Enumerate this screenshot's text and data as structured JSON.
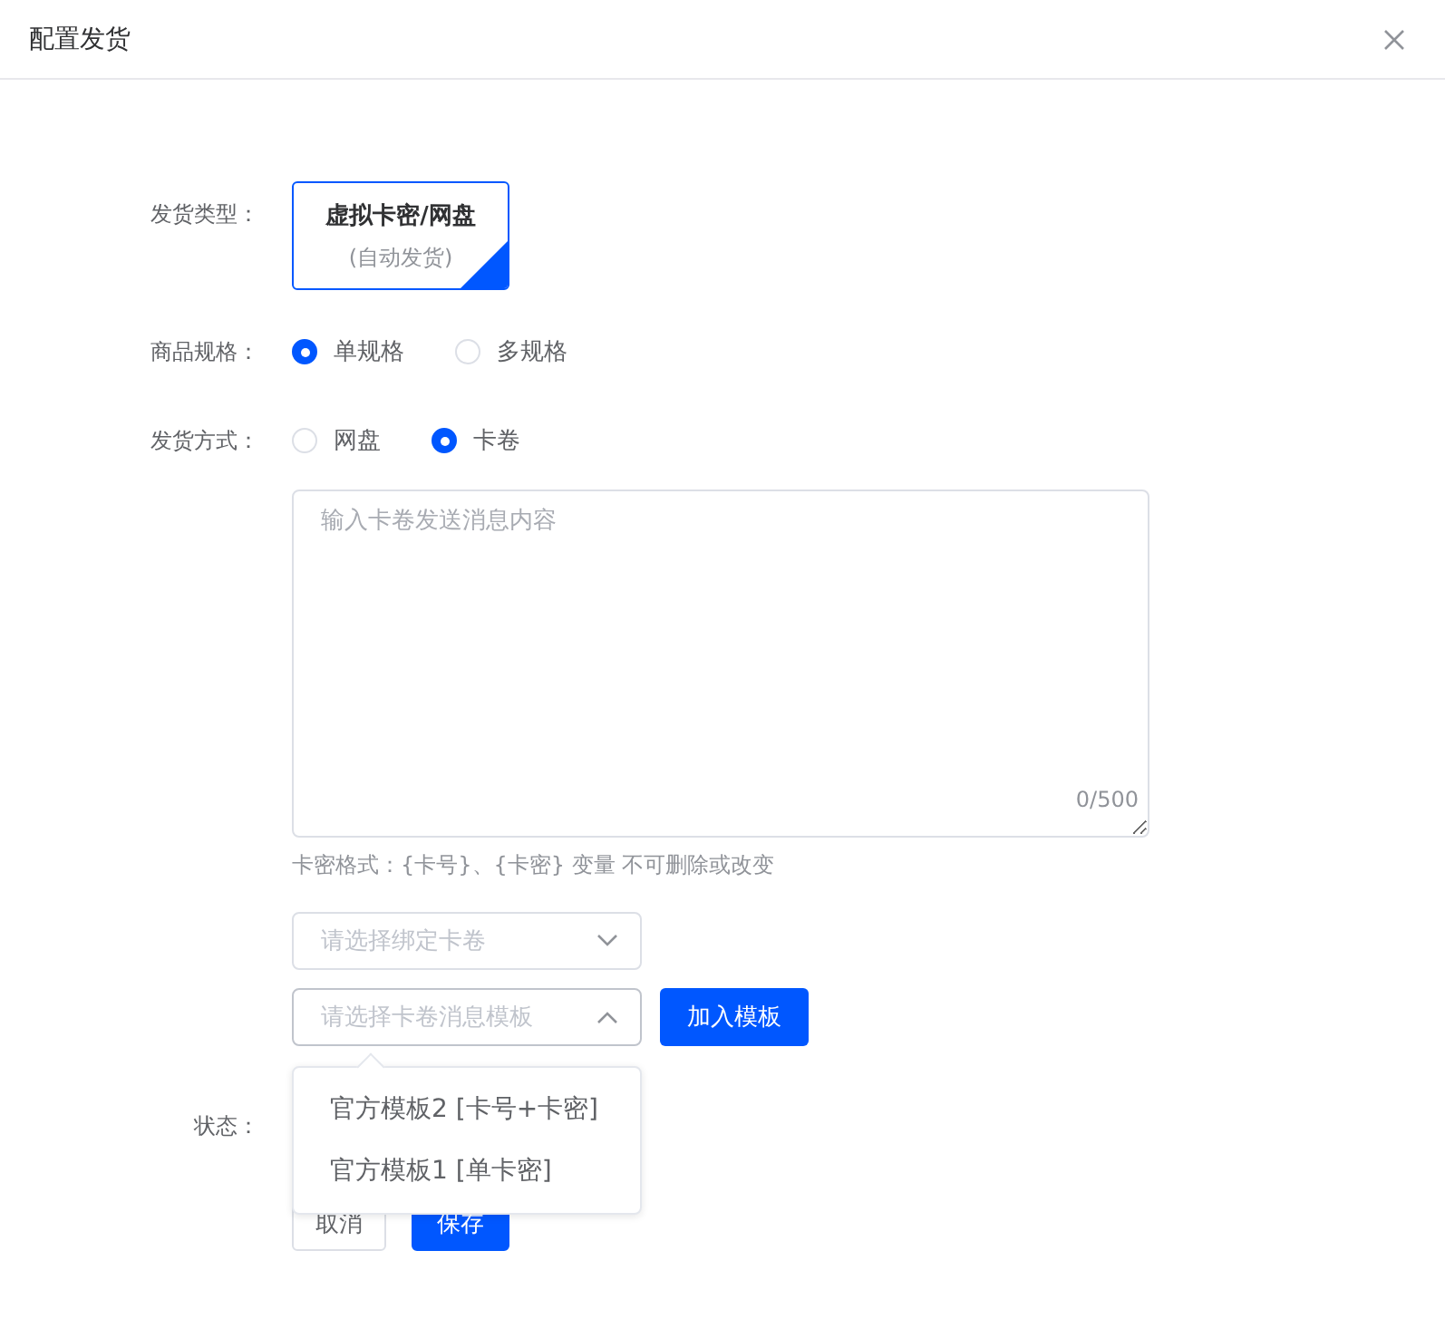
{
  "dialog": {
    "title": "配置发货"
  },
  "form": {
    "delivery_type": {
      "label": "发货类型：",
      "options": [
        {
          "title": "虚拟卡密/网盘",
          "subtitle": "(自动发货)",
          "selected": true
        }
      ]
    },
    "spec": {
      "label": "商品规格：",
      "options": [
        {
          "label": "单规格",
          "selected": true
        },
        {
          "label": "多规格",
          "selected": false
        }
      ]
    },
    "method": {
      "label": "发货方式：",
      "options": [
        {
          "label": "网盘",
          "selected": false
        },
        {
          "label": "卡卷",
          "selected": true
        }
      ]
    },
    "message": {
      "placeholder": "输入卡卷发送消息内容",
      "counter": "0/500",
      "hint": "卡密格式：{卡号}、{卡密} 变量 不可删除或改变"
    },
    "bind_select": {
      "placeholder": "请选择绑定卡卷",
      "expanded": false
    },
    "template_select": {
      "placeholder": "请选择卡卷消息模板",
      "expanded": true,
      "options": [
        {
          "label": "官方模板2 [卡号+卡密]"
        },
        {
          "label": "官方模板1 [单卡密]"
        }
      ]
    },
    "add_template_button": "加入模板",
    "status": {
      "label": "状态："
    },
    "buttons": [
      {
        "label": "取消",
        "kind": "default"
      },
      {
        "label": "保存",
        "kind": "primary"
      }
    ]
  }
}
